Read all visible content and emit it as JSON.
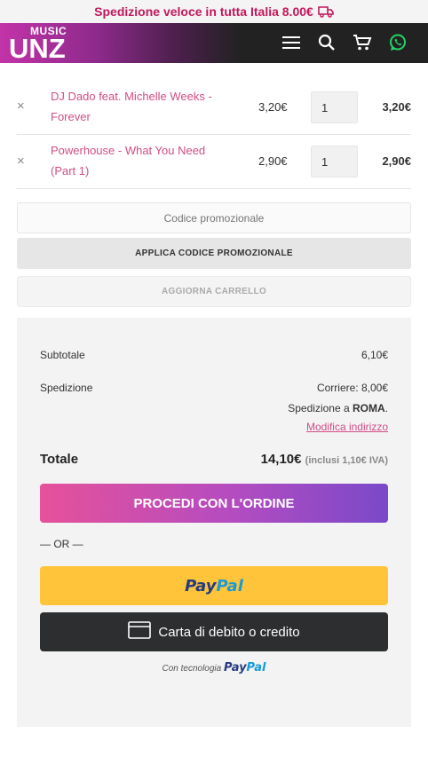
{
  "topbar": {
    "text": "Spedizione veloce in tutta Italia 8.00€",
    "icon": "truck-icon"
  },
  "header": {
    "logo_small": "MUSIC",
    "logo_big": "UNZ",
    "icons": [
      "menu-icon",
      "search-icon",
      "cart-icon",
      "whatsapp-icon"
    ]
  },
  "cart": {
    "items": [
      {
        "remove": "×",
        "title": "DJ Dado feat. Michelle Weeks - Forever",
        "price": "3,20€",
        "qty": "1",
        "subtotal": "3,20€"
      },
      {
        "remove": "×",
        "title": "Powerhouse - What You Need (Part 1)",
        "price": "2,90€",
        "qty": "1",
        "subtotal": "2,90€"
      }
    ],
    "coupon_placeholder": "Codice promozionale",
    "apply_label": "APPLICA CODICE PROMOZIONALE",
    "update_label": "AGGIORNA CARRELLO"
  },
  "totals": {
    "subtotal_label": "Subtotale",
    "subtotal_value": "6,10€",
    "shipping_label": "Spedizione",
    "shipping_method": "Corriere: 8,00€",
    "shipping_dest_prefix": "Spedizione a",
    "shipping_dest_city": "ROMA",
    "shipping_dest_suffix": ".",
    "change_address": "Modifica indirizzo",
    "total_label": "Totale",
    "total_value": "14,10€",
    "total_tax_note": "(inclusi 1,10€ IVA)",
    "checkout_label": "PROCEDI CON L'ORDINE",
    "or_label": "— OR —",
    "paypal_a": "Pay",
    "paypal_b": "Pal",
    "card_label": "Carta di debito o credito",
    "powered_by": "Con tecnologia"
  },
  "colors": {
    "accent": "#d24d84",
    "brand_pink": "#c2185b",
    "paypal_yellow": "#ffc439",
    "card_dark": "#2c2e2f"
  }
}
